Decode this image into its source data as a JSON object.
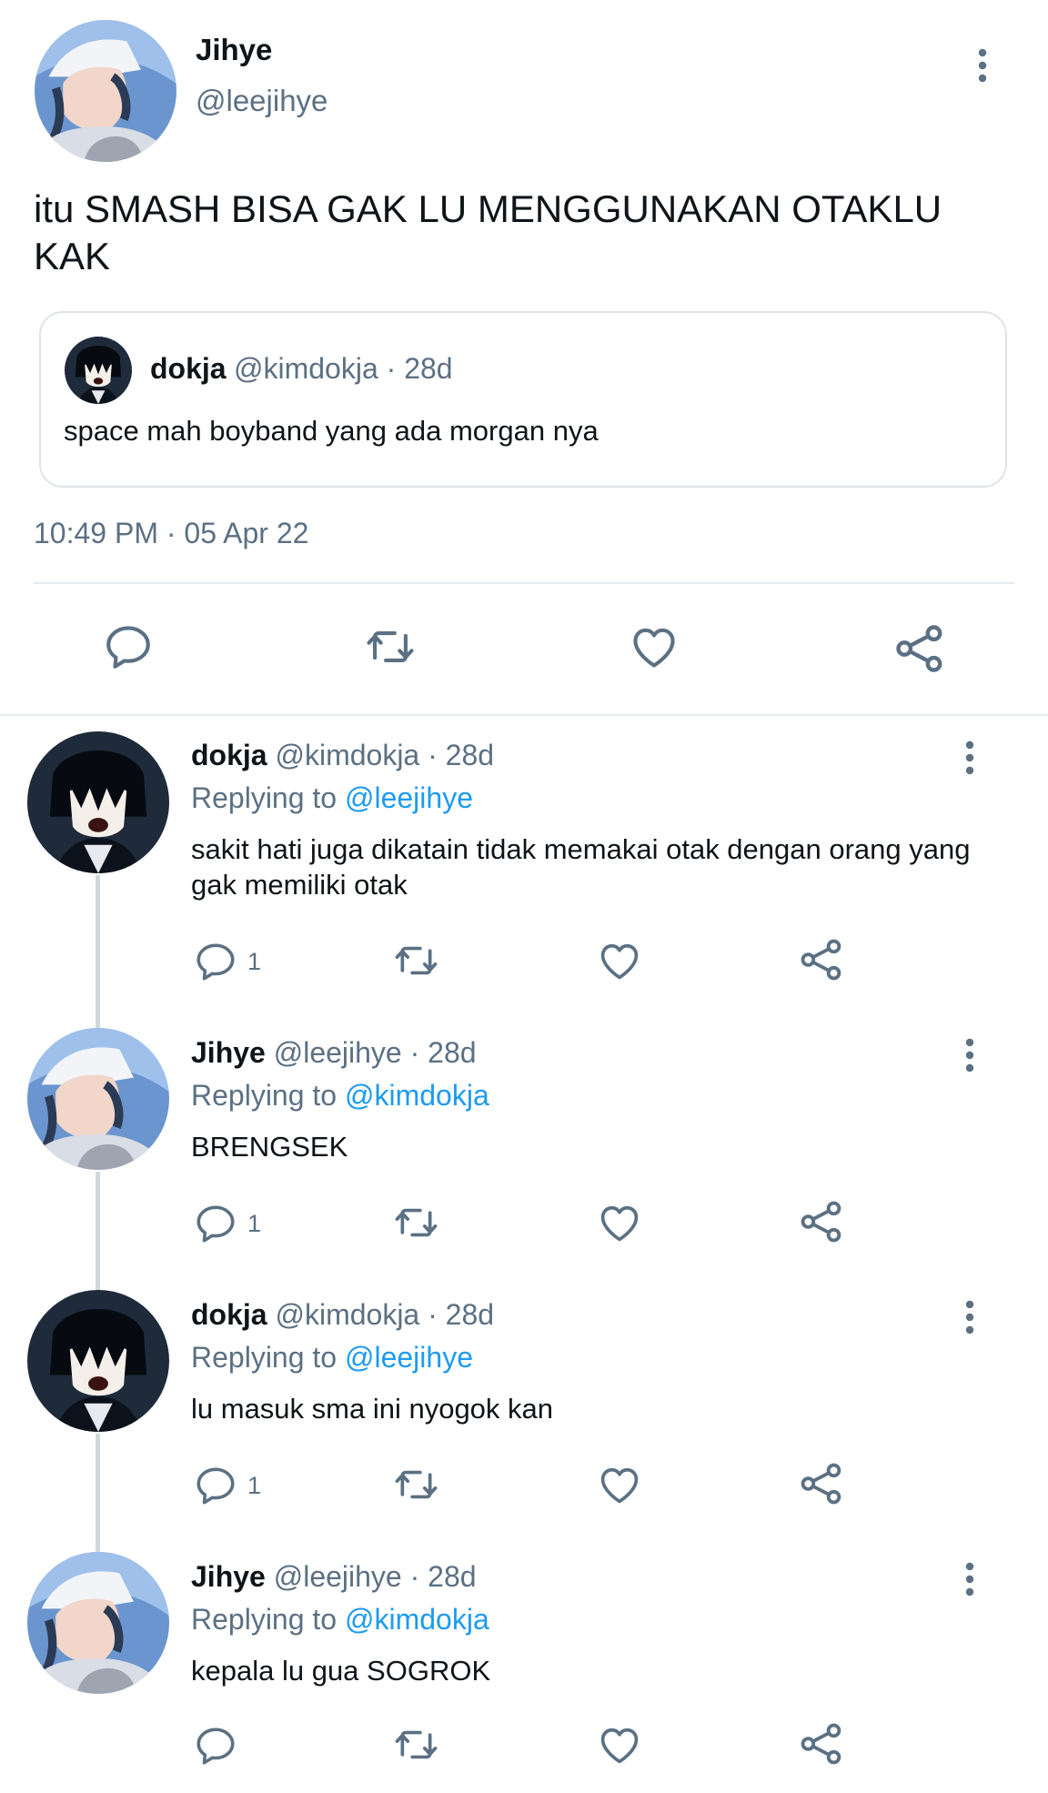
{
  "colors": {
    "text": "#0f1419",
    "secondary": "#5b7083",
    "link": "#1d9bf0",
    "border": "#dfe4e8"
  },
  "main_tweet": {
    "author_name": "Jihye",
    "author_handle": "@leejihye",
    "text": "itu SMASH BISA GAK LU MENGGUNAKAN OTAKLU KAK",
    "quote": {
      "author_name": "dokja",
      "author_meta": "@kimdokja · 28d",
      "text": "space mah boyband yang ada morgan nya"
    },
    "timestamp": "10:49 PM · 05 Apr 22",
    "actions": [
      "reply-icon",
      "retweet-icon",
      "like-icon",
      "share-icon"
    ]
  },
  "replies": [
    {
      "author_name": "dokja",
      "meta": "@kimdokja · 28d",
      "replying_prefix": "Replying to",
      "replying_handle": "@leejihye",
      "text": "sakit hati juga dikatain tidak memakai otak dengan orang yang gak memiliki otak",
      "reply_count": "1"
    },
    {
      "author_name": "Jihye",
      "meta": "@leejihye · 28d",
      "replying_prefix": "Replying to",
      "replying_handle": "@kimdokja",
      "text": "BRENGSEK",
      "reply_count": "1"
    },
    {
      "author_name": "dokja",
      "meta": "@kimdokja · 28d",
      "replying_prefix": "Replying to",
      "replying_handle": "@leejihye",
      "text": "lu masuk sma ini nyogok kan",
      "reply_count": "1"
    },
    {
      "author_name": "Jihye",
      "meta": "@leejihye · 28d",
      "replying_prefix": "Replying to",
      "replying_handle": "@kimdokja",
      "text": "kepala lu gua SOGROK",
      "reply_count": ""
    }
  ]
}
